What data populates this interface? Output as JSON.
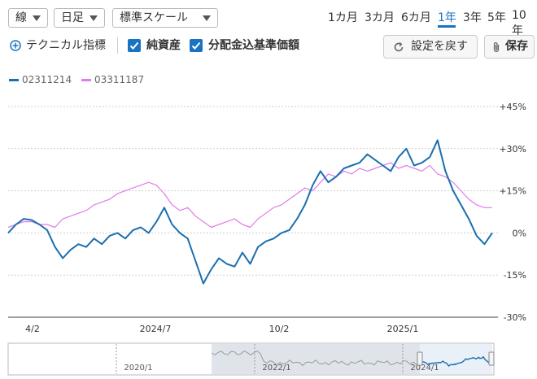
{
  "toolbar": {
    "chart_type": "線",
    "interval": "日足",
    "scale": "標準スケール",
    "ranges": [
      "1カ月",
      "3カ月",
      "6カ月",
      "1年",
      "3年",
      "5年",
      "10年"
    ],
    "active_range": "1年",
    "technical_label": "テクニカル指標",
    "checkbox_nav": "純資産",
    "checkbox_dist": "分配金込基準価額",
    "reset_label": "設定を戻す",
    "save_label": "保存"
  },
  "colors": {
    "accent": "#1a73c2",
    "series_primary": "#1a6fb0",
    "series_secondary": "#e07ce8",
    "navigator_fill": "#dfe4ea"
  },
  "chart_data": {
    "type": "line",
    "x_tick_labels": [
      "4/2",
      "2024/7",
      "10/2",
      "2025/1"
    ],
    "y_tick_labels": [
      "+45%",
      "+30%",
      "+15%",
      "0%",
      "-15%",
      "-30%"
    ],
    "ylim": [
      -30,
      45
    ],
    "grid": true,
    "legend_position": "top-left",
    "series": [
      {
        "name": "02311214",
        "color": "#1a6fb0",
        "values": [
          0,
          3,
          5,
          4.6,
          3,
          1,
          -5,
          -9,
          -6,
          -4,
          -5,
          -2,
          -4,
          -1,
          0,
          -2,
          1,
          2,
          0,
          4,
          9,
          3,
          0,
          -2,
          -10,
          -18,
          -13,
          -9,
          -11,
          -12,
          -7,
          -11,
          -5,
          -3,
          -2,
          0,
          1,
          5,
          10,
          17,
          22,
          18,
          20,
          23,
          24,
          25,
          28,
          26,
          24,
          22,
          27,
          30,
          24,
          25,
          27,
          33,
          22,
          15,
          10,
          5,
          -1,
          -4,
          0
        ]
      },
      {
        "name": "03311187",
        "color": "#e07ce8",
        "values": [
          2,
          3,
          4,
          4,
          3,
          3,
          2,
          5,
          6,
          7,
          8,
          10,
          11,
          12,
          14,
          15,
          16,
          17,
          18,
          17,
          14,
          10,
          8,
          9,
          6,
          4,
          2,
          3,
          4,
          5,
          3,
          2,
          5,
          7,
          9,
          10,
          12,
          14,
          16,
          15,
          18,
          21,
          20,
          22,
          21,
          23,
          22,
          23,
          24,
          25,
          23,
          24,
          23,
          22,
          24,
          21,
          20,
          18,
          15,
          12,
          10,
          9,
          9
        ]
      }
    ],
    "navigator": {
      "tick_labels": [
        "2020/1",
        "2022/1",
        "2024/1"
      ]
    }
  }
}
